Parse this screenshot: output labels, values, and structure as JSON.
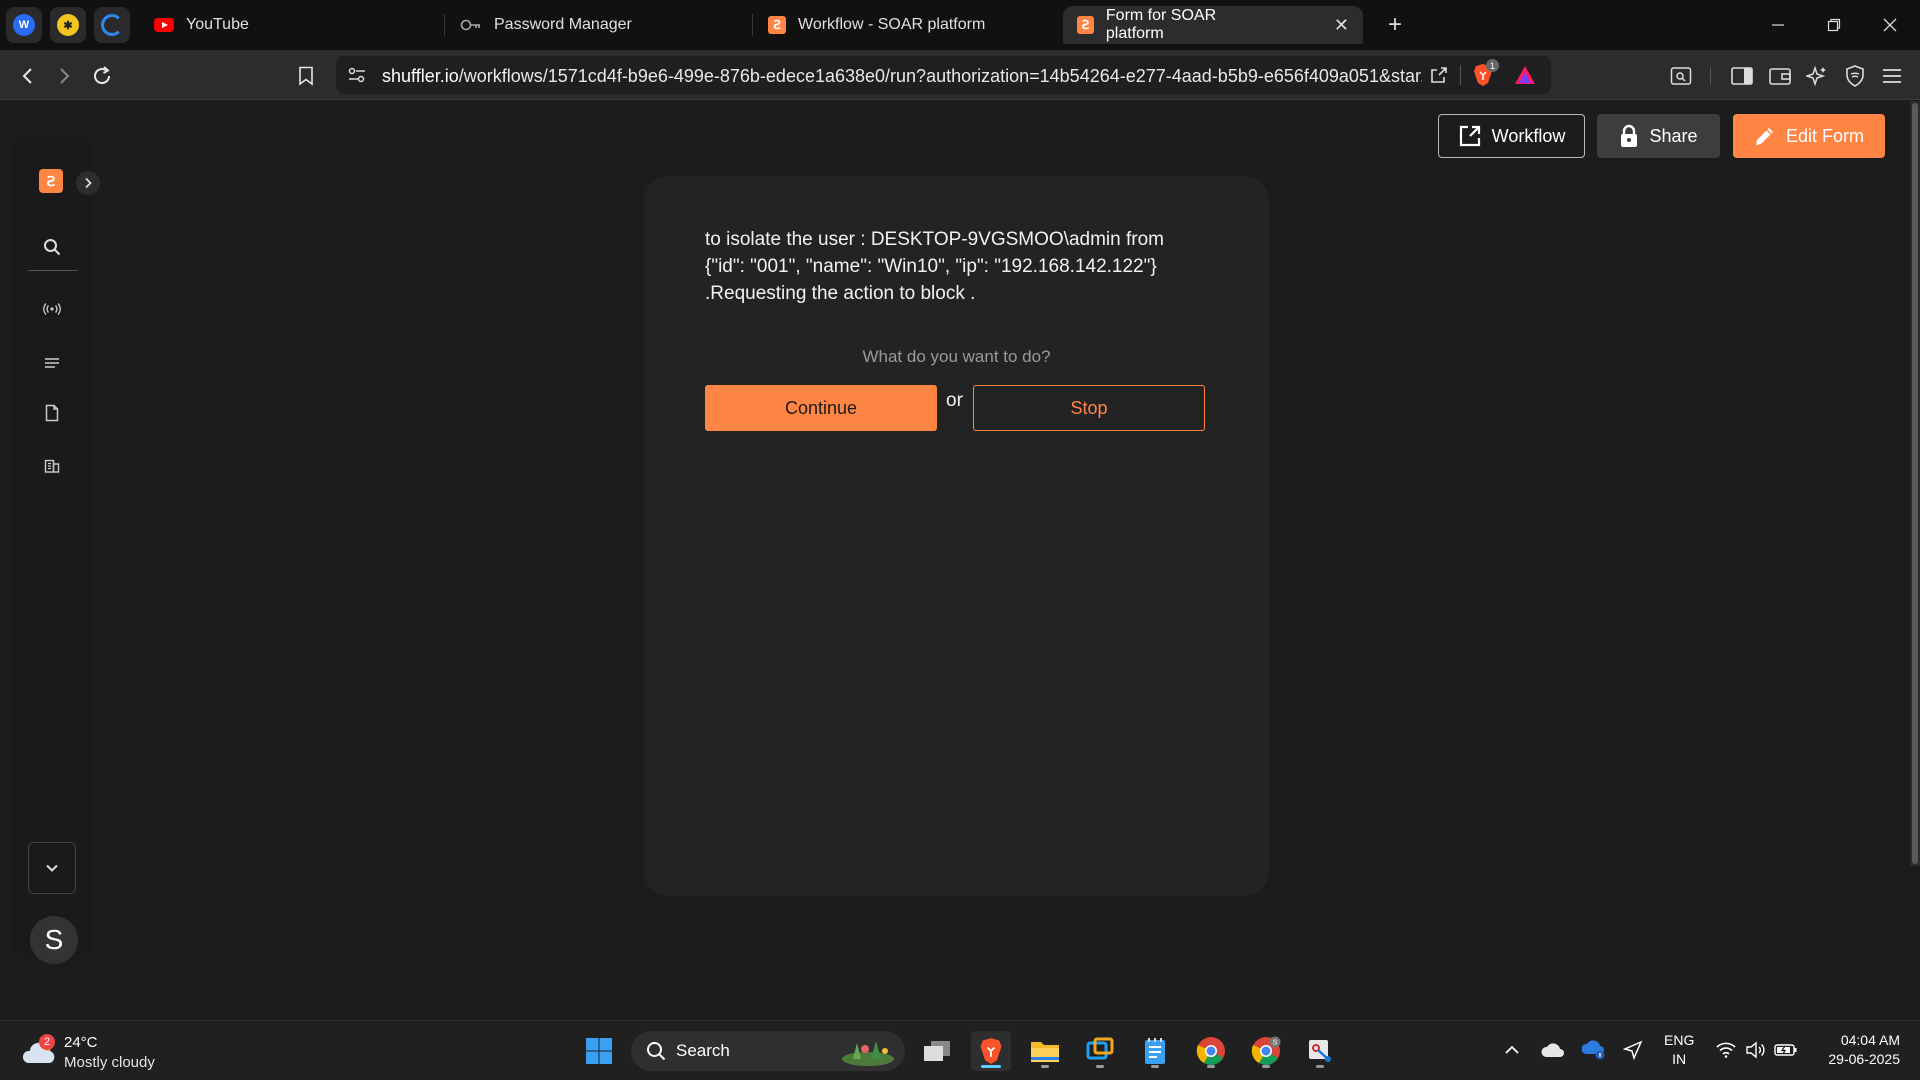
{
  "browser": {
    "tabs": [
      {
        "title": "YouTube",
        "icon": "youtube-icon",
        "active": false
      },
      {
        "title": "Password Manager",
        "icon": "key-icon",
        "active": false
      },
      {
        "title": "Workflow - SOAR platform",
        "icon": "shuffle-icon",
        "active": false
      },
      {
        "title": "Form for SOAR platform",
        "icon": "shuffle-icon",
        "active": true
      }
    ],
    "url_host": "shuffler.io",
    "url_path": "/workflows/1571cd4f-b9e6-499e-876b-edece1a638e0/run?authorization=14b54264-e277-4aad-b5b9-e656f409a051&star...",
    "brave_badge_count": "1"
  },
  "header": {
    "workflow_label": "Workflow",
    "share_label": "Share",
    "edit_label": "Edit Form"
  },
  "sidebar": {
    "avatar_letter": "S",
    "items": [
      "search-icon",
      "broadcast-icon",
      "list-icon",
      "file-icon",
      "building-icon"
    ]
  },
  "form": {
    "message_lines": [
      "to isolate the user : DESKTOP-9VGSMOO\\admin from",
      "{\"id\": \"001\", \"name\": \"Win10\", \"ip\": \"192.168.142.122\"}",
      ".Requesting the action to block ."
    ],
    "prompt": "What do you want to do?",
    "continue_label": "Continue",
    "or_label": "or",
    "stop_label": "Stop"
  },
  "taskbar": {
    "weather_badge": "2",
    "temperature": "24°C",
    "condition": "Mostly cloudy",
    "search_label": "Search",
    "lang_line1": "ENG",
    "lang_line2": "IN",
    "time": "04:04 AM",
    "date": "29-06-2025"
  },
  "colors": {
    "accent": "#ff8544",
    "page_bg": "#1c1c1c",
    "card_bg": "#232323"
  }
}
